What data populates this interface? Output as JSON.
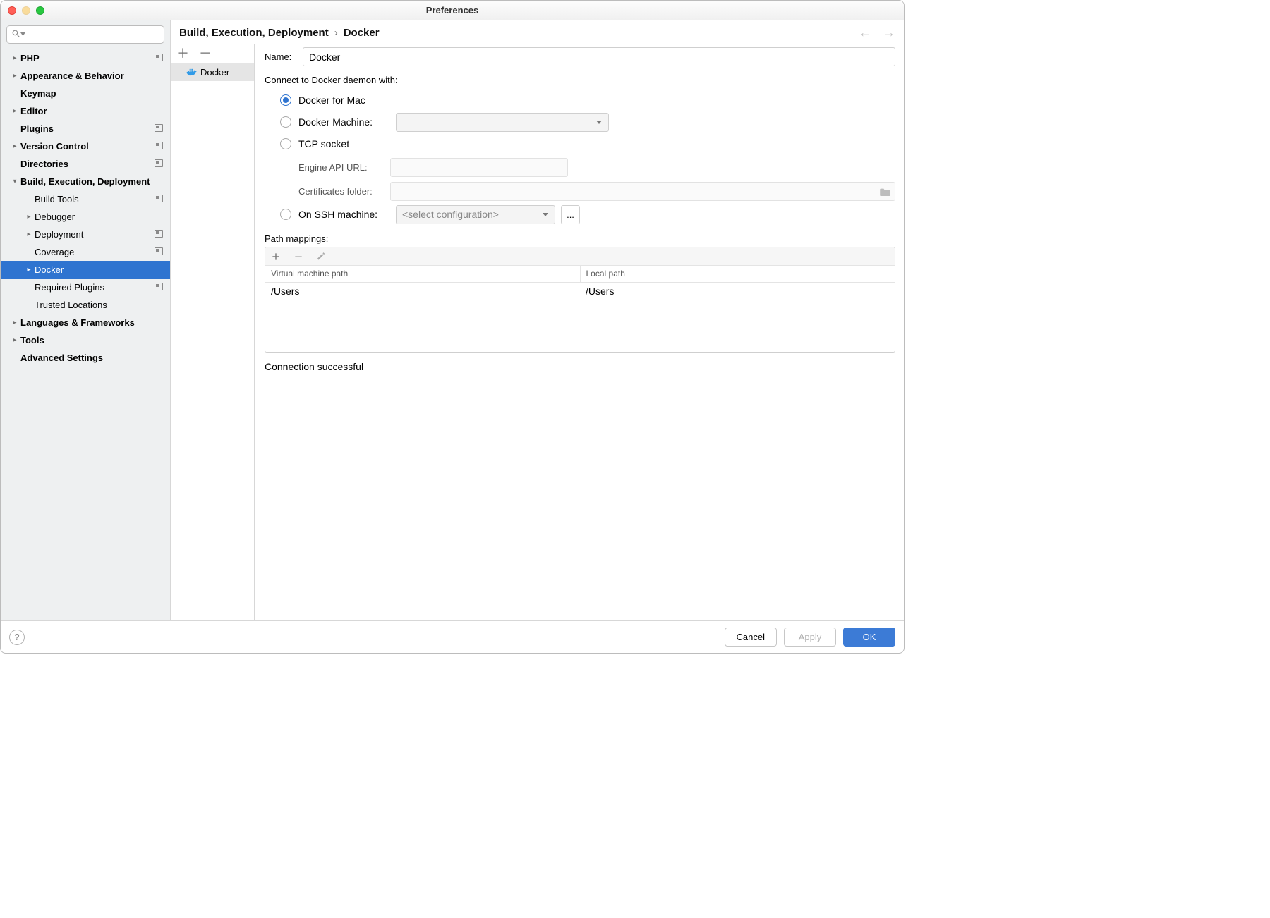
{
  "window": {
    "title": "Preferences"
  },
  "nav": {
    "back": "←",
    "forward": "→"
  },
  "breadcrumb": {
    "parent": "Build, Execution, Deployment",
    "current": "Docker",
    "sep": "›"
  },
  "sidebar": {
    "search_placeholder": "",
    "items": [
      {
        "label": "PHP",
        "arrow": ">",
        "bold": true,
        "badge": true,
        "lvl": 1
      },
      {
        "label": "Appearance & Behavior",
        "arrow": ">",
        "bold": true,
        "lvl": 1
      },
      {
        "label": "Keymap",
        "arrow": "",
        "bold": true,
        "lvl": 1,
        "noarrow": true
      },
      {
        "label": "Editor",
        "arrow": ">",
        "bold": true,
        "lvl": 1
      },
      {
        "label": "Plugins",
        "arrow": "",
        "bold": true,
        "badge": true,
        "lvl": 1,
        "noarrow": true
      },
      {
        "label": "Version Control",
        "arrow": ">",
        "bold": true,
        "badge": true,
        "lvl": 1
      },
      {
        "label": "Directories",
        "arrow": "",
        "bold": true,
        "badge": true,
        "lvl": 1,
        "noarrow": true
      },
      {
        "label": "Build, Execution, Deployment",
        "arrow": "v",
        "bold": true,
        "lvl": 1
      },
      {
        "label": "Build Tools",
        "arrow": "",
        "badge": true,
        "lvl": 2,
        "noarrow": true
      },
      {
        "label": "Debugger",
        "arrow": ">",
        "lvl": 2
      },
      {
        "label": "Deployment",
        "arrow": ">",
        "badge": true,
        "lvl": 2
      },
      {
        "label": "Coverage",
        "arrow": "",
        "badge": true,
        "lvl": 2,
        "noarrow": true
      },
      {
        "label": "Docker",
        "arrow": ">",
        "lvl": 2,
        "selected": true
      },
      {
        "label": "Required Plugins",
        "arrow": "",
        "badge": true,
        "lvl": 2,
        "noarrow": true
      },
      {
        "label": "Trusted Locations",
        "arrow": "",
        "lvl": 2,
        "noarrow": true
      },
      {
        "label": "Languages & Frameworks",
        "arrow": ">",
        "bold": true,
        "lvl": 1
      },
      {
        "label": "Tools",
        "arrow": ">",
        "bold": true,
        "lvl": 1
      },
      {
        "label": "Advanced Settings",
        "arrow": "",
        "bold": true,
        "lvl": 1,
        "noarrow": true
      }
    ]
  },
  "list": {
    "plus": "＋",
    "minus": "－",
    "rows": [
      {
        "label": "Docker"
      }
    ]
  },
  "form": {
    "name_label": "Name:",
    "name_value": "Docker",
    "connect_label": "Connect to Docker daemon with:",
    "opt_mac": "Docker for Mac",
    "opt_machine": "Docker Machine:",
    "machine_value": "",
    "opt_tcp": "TCP socket",
    "engine_label": "Engine API URL:",
    "engine_value": "",
    "cert_label": "Certificates folder:",
    "cert_value": "",
    "opt_ssh": "On SSH machine:",
    "ssh_placeholder": "<select configuration>",
    "ellipsis": "...",
    "path_label": "Path mappings:",
    "col_vm": "Virtual machine path",
    "col_local": "Local path",
    "row_vm": "/Users",
    "row_local": "/Users",
    "status": "Connection successful"
  },
  "footer": {
    "help": "?",
    "cancel": "Cancel",
    "apply": "Apply",
    "ok": "OK"
  }
}
